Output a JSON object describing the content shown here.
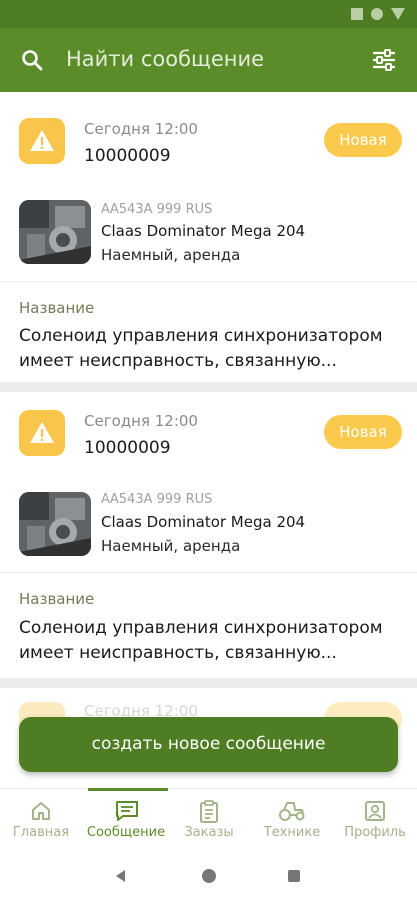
{
  "search": {
    "placeholder": "Найти сообщение"
  },
  "messages": [
    {
      "date": "Сегодня 12:00",
      "number": "10000009",
      "status": "Новая",
      "plate": "АА543А 999 RUS",
      "model": "Claas Dominator Mega 204",
      "ownership": "Наемный, аренда",
      "name_label": "Название",
      "description": "Соленоид управления синхронизатором имеет неисправность, связанную..."
    },
    {
      "date": "Сегодня 12:00",
      "number": "10000009",
      "status": "Новая",
      "plate": "АА543А 999 RUS",
      "model": "Claas Dominator Mega 204",
      "ownership": "Наемный, аренда",
      "name_label": "Название",
      "description": "Соленоид управления синхронизатором имеет неисправность, связанную..."
    },
    {
      "date": "Сегодня 12:00",
      "number": "",
      "status": "",
      "plate": "",
      "model": "",
      "ownership": "",
      "name_label": "",
      "description": ""
    }
  ],
  "fab": {
    "label": "создать новое сообщение"
  },
  "nav": {
    "items": [
      {
        "label": "Главная",
        "icon": "home-icon"
      },
      {
        "label": "Сообщение",
        "icon": "message-icon"
      },
      {
        "label": "Заказы",
        "icon": "orders-icon"
      },
      {
        "label": "Технике",
        "icon": "tractor-icon"
      },
      {
        "label": "Профиль",
        "icon": "profile-icon"
      }
    ],
    "active_index": 1
  },
  "colors": {
    "primary": "#5b8c2a",
    "primary_dark": "#4e7d23",
    "badge": "#fbc94c",
    "warning": "#f9c54a"
  }
}
